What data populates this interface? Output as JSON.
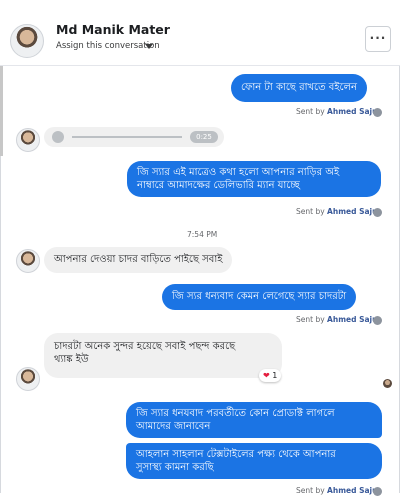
{
  "header": {
    "name": "Md Manik Mater",
    "assign": "Assign this conversation",
    "more": "···"
  },
  "messages": {
    "m1": "ফোন টা কাছে রাখতে বইলেন",
    "sent1": "Sent by",
    "sender1": "Ahmed Saju",
    "audio_time": "0:25",
    "m2_line1": "জি স্যার এই মাত্রেও কথা হলো আপনার নাড়ির অই",
    "m2_line2": "নাম্বারে আমাদক্ষের ডেলিভারি ম্যান যাচ্ছে",
    "sent2": "Sent by",
    "sender2": "Ahmed Saju",
    "time": "7:54 PM",
    "m3": "আপনার দেওয়া চাদর বাড়িতে পাইছে সবাই",
    "m4": "জি স্যর ধন্যবাদ কেমন লেগেছে স্যার চাদরটা",
    "sent4": "Sent by",
    "sender4": "Ahmed Saju",
    "m5_line1": "চাদরটা অনেক সুন্দর হয়েছে সবাই পছন্দ করছে",
    "m5_line2": "থ্যাঙ্ক ইউ",
    "reaction_count": "1",
    "m6_line1": "জি স্যার ধনযবাদ পরবর্তীতে কোন প্রোডাক্ট লাগলে",
    "m6_line2": "আমাদের জানাবেন",
    "m7_line1": "আহলান সাহলান টেক্সটাইলের পক্ষ্য থেকে আপনার",
    "m7_line2": "সুসাস্থ্য কামনা করছি",
    "sent7": "Sent by",
    "sender7": "Ahmed Saju"
  },
  "colors": {
    "outgoing": "#1b74e4",
    "incoming": "#f0f0f0"
  }
}
